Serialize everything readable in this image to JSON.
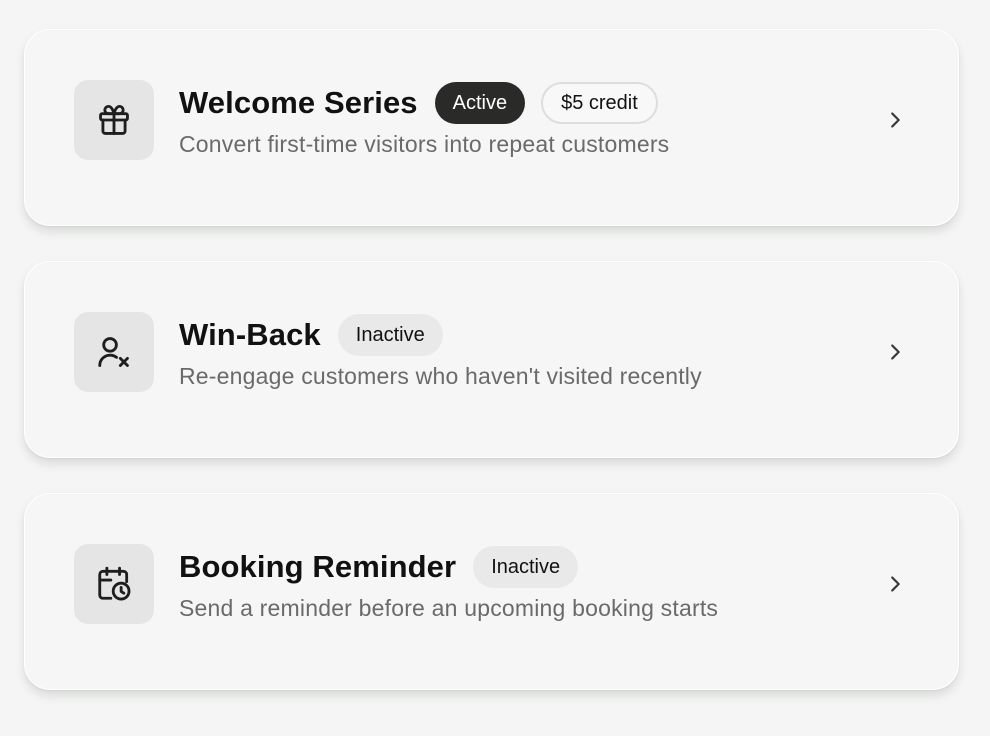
{
  "automations": [
    {
      "title": "Welcome Series",
      "status": "Active",
      "reward": "$5 credit",
      "description": "Convert first-time visitors into repeat customers",
      "icon": "gift-icon"
    },
    {
      "title": "Win-Back",
      "status": "Inactive",
      "description": "Re-engage customers who haven't visited recently",
      "icon": "user-x-icon"
    },
    {
      "title": "Booking Reminder",
      "status": "Inactive",
      "description": "Send a reminder before an upcoming booking starts",
      "icon": "calendar-clock-icon"
    }
  ],
  "colors": {
    "background": "#f4f5f4",
    "card": "#f5f6f5",
    "icon_tile": "#e4e5e4",
    "active_badge": "#2a2a28",
    "inactive_badge": "#e8e9e8",
    "subtitle_text": "#6a6a6a"
  }
}
